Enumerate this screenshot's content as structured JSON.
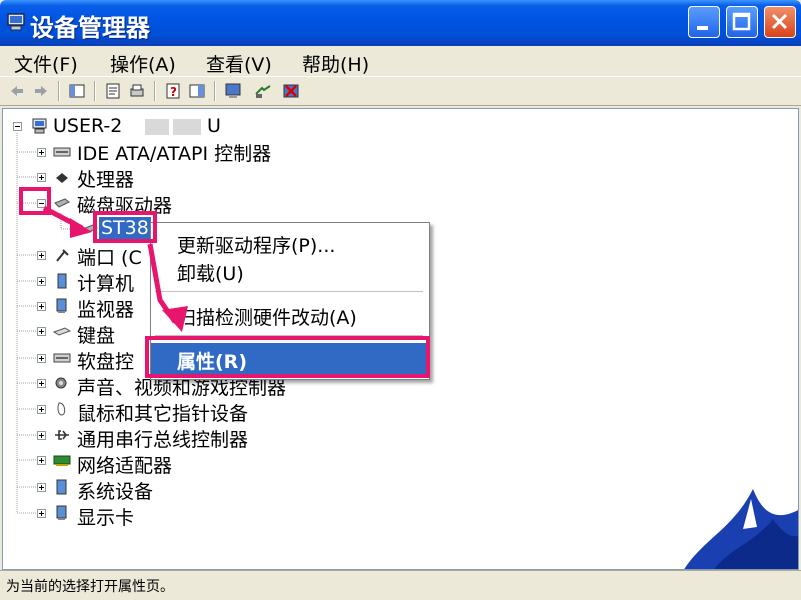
{
  "window": {
    "title": "设备管理器"
  },
  "menu": [
    "文件(F)",
    "操作(A)",
    "查看(V)",
    "帮助(H)"
  ],
  "tree": {
    "root": "USER-2",
    "root_suffix": "U",
    "items": [
      {
        "label": "IDE ATA/ATAPI 控制器"
      },
      {
        "label": "处理器"
      },
      {
        "label": "磁盘驱动器"
      },
      {
        "label": "ST38"
      },
      {
        "label": "端口 (C"
      },
      {
        "label": "计算机"
      },
      {
        "label": "监视器"
      },
      {
        "label": "键盘"
      },
      {
        "label": "软盘控"
      },
      {
        "label": "声音、视频和游戏控制器"
      },
      {
        "label": "鼠标和其它指针设备"
      },
      {
        "label": "通用串行总线控制器"
      },
      {
        "label": "网络适配器"
      },
      {
        "label": "系统设备"
      },
      {
        "label": "显示卡"
      }
    ]
  },
  "context_menu": {
    "items": [
      "更新驱动程序(P)...",
      "卸载(U)",
      "扫描检测硬件改动(A)",
      "属性(R)"
    ]
  },
  "status": "为当前的选择打开属性页。",
  "colors": {
    "title": "#0054e3",
    "selection": "#316ac5",
    "annotation": "#e8156c"
  }
}
